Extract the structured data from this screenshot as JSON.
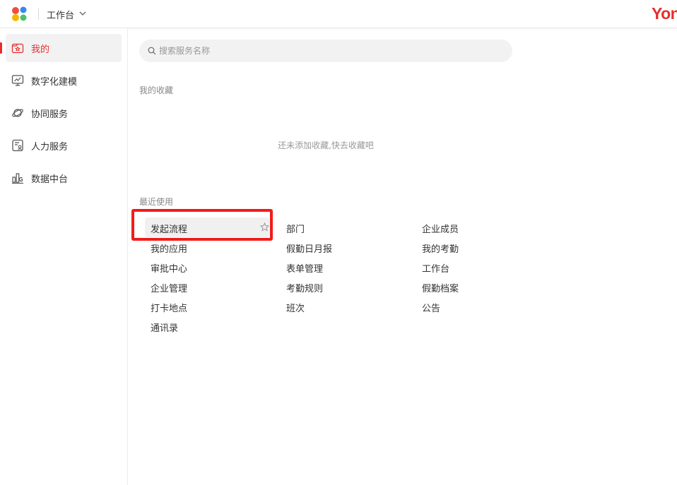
{
  "header": {
    "workspace_label": "工作台",
    "brand_text": "Yon"
  },
  "sidebar": {
    "items": [
      {
        "label": "我的",
        "icon": "my-favorites-icon",
        "active": true
      },
      {
        "label": "数字化建模",
        "icon": "monitor-chart-icon",
        "active": false
      },
      {
        "label": "协同服务",
        "icon": "planet-icon",
        "active": false
      },
      {
        "label": "人力服务",
        "icon": "person-doc-icon",
        "active": false
      },
      {
        "label": "数据中台",
        "icon": "bar-chart-icon",
        "active": false
      }
    ]
  },
  "search": {
    "placeholder": "搜索服务名称",
    "value": ""
  },
  "favorites": {
    "title": "我的收藏",
    "empty_text": "还未添加收藏,快去收藏吧"
  },
  "recent": {
    "title": "最近使用",
    "columns": [
      [
        "发起流程",
        "我的应用",
        "审批中心",
        "企业管理",
        "打卡地点",
        "通讯录"
      ],
      [
        "部门",
        "假勤日月报",
        "表单管理",
        "考勤规则",
        "班次"
      ],
      [
        "企业成员",
        "我的考勤",
        "工作台",
        "假勤档案",
        "公告"
      ]
    ]
  },
  "colors": {
    "accent": "#e62e2e",
    "highlight_box": "#f21b1b"
  }
}
